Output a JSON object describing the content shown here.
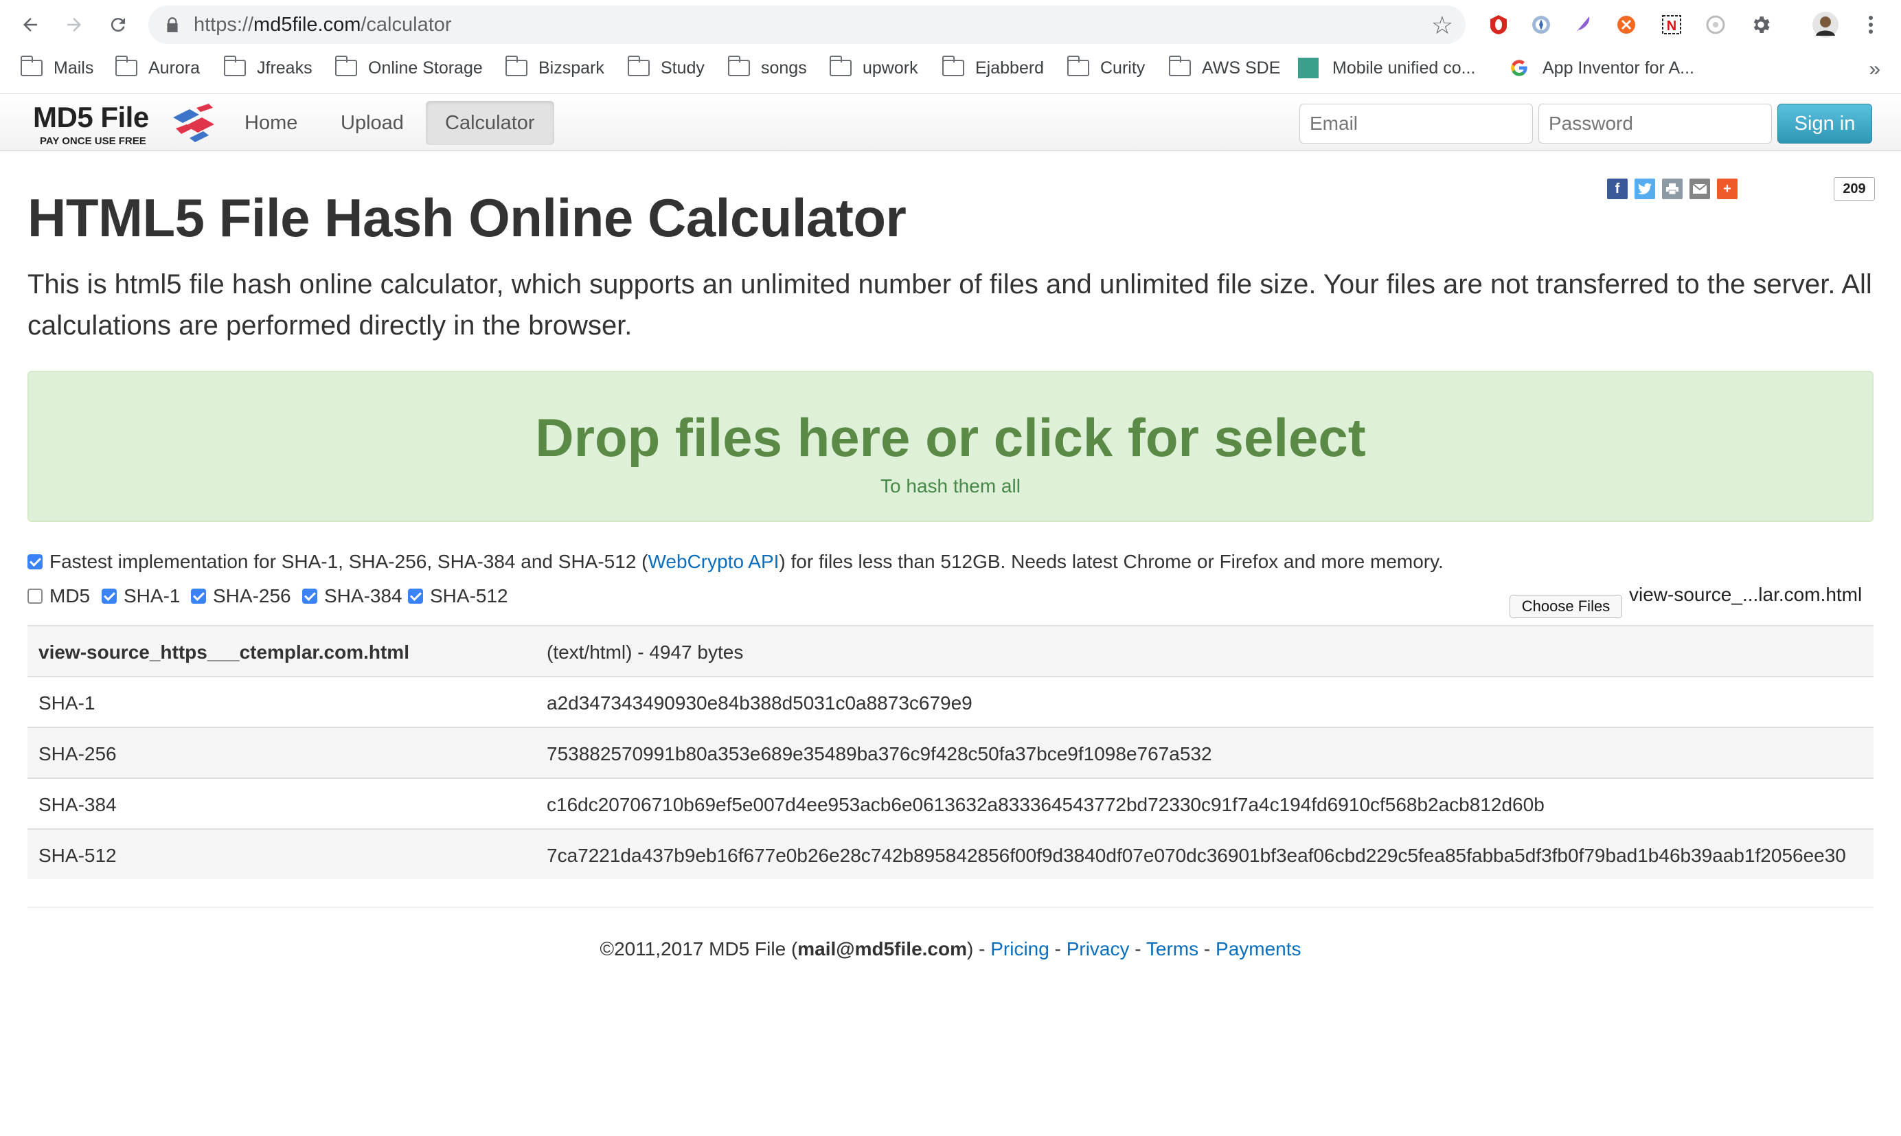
{
  "browser": {
    "url_scheme": "https://",
    "url_host": "md5file.com",
    "url_path": "/calculator",
    "bookmarks": [
      {
        "label": "Mails",
        "icon": "folder-icon"
      },
      {
        "label": "Aurora",
        "icon": "folder-icon"
      },
      {
        "label": "Jfreaks",
        "icon": "folder-icon"
      },
      {
        "label": "Online Storage",
        "icon": "folder-icon"
      },
      {
        "label": "Bizspark",
        "icon": "folder-icon"
      },
      {
        "label": "Study",
        "icon": "folder-icon"
      },
      {
        "label": "songs",
        "icon": "folder-icon"
      },
      {
        "label": "upwork",
        "icon": "folder-icon"
      },
      {
        "label": "Ejabberd",
        "icon": "folder-icon"
      },
      {
        "label": "Curity",
        "icon": "folder-icon"
      },
      {
        "label": "AWS SDE",
        "icon": "folder-icon"
      },
      {
        "label": "Mobile unified co...",
        "icon": "teal-square-icon"
      },
      {
        "label": "App Inventor for A...",
        "icon": "google-g-icon"
      }
    ],
    "bookmarks_more": "»"
  },
  "nav": {
    "brand": "MD5 File",
    "brand_tagline": "PAY ONCE USE FREE",
    "links": [
      "Home",
      "Upload",
      "Calculator"
    ],
    "active_link": "Calculator",
    "email_placeholder": "Email",
    "password_placeholder": "Password",
    "signin_label": "Sign in"
  },
  "share": {
    "icons": [
      "facebook-icon",
      "twitter-icon",
      "print-icon",
      "email-icon",
      "plus-icon"
    ],
    "count": "209"
  },
  "main": {
    "title": "HTML5 File Hash Online Calculator",
    "lead": "This is html5 file hash online calculator, which supports an unlimited number of files and unlimited file size. Your files are not transferred to the server. All calculations are performed directly in the browser.",
    "drop_title": "Drop files here or click for select",
    "drop_subtitle": "To hash them all",
    "fastest_prefix": "Fastest implementation for SHA-1, SHA-256, SHA-384 and SHA-512 (",
    "fastest_link": "WebCrypto API",
    "fastest_suffix": ") for files less than 512GB. Needs latest Chrome or Firefox and more memory.",
    "algorithms": [
      {
        "label": "MD5",
        "checked": false
      },
      {
        "label": "SHA-1",
        "checked": true
      },
      {
        "label": "SHA-256",
        "checked": true
      },
      {
        "label": "SHA-384",
        "checked": true
      },
      {
        "label": "SHA-512",
        "checked": true
      }
    ],
    "choose_files_label": "Choose Files",
    "chosen_file": "view-source_...lar.com.html"
  },
  "results": {
    "file_name": "view-source_https___ctemplar.com.html",
    "file_info": "(text/html) - 4947 bytes",
    "rows": [
      {
        "algo": "SHA-1",
        "hash": "a2d347343490930e84b388d5031c0a8873c679e9"
      },
      {
        "algo": "SHA-256",
        "hash": "753882570991b80a353e689e35489ba376c9f428c50fa37bce9f1098e767a532"
      },
      {
        "algo": "SHA-384",
        "hash": "c16dc20706710b69ef5e007d4ee953acb6e0613632a833364543772bd72330c91f7a4c194fd6910cf568b2acb812d60b"
      },
      {
        "algo": "SHA-512",
        "hash": "7ca7221da437b9eb16f677e0b26e28c742b895842856f00f9d3840df07e070dc36901bf3eaf06cbd229c5fea85fabba5df3fb0f79bad1b46b39aab1f2056ee30"
      }
    ]
  },
  "footer": {
    "copyright_prefix": "©2011,2017 MD5 File (",
    "email": "mail@md5file.com",
    "copyright_suffix": ") - ",
    "links": [
      "Pricing",
      "Privacy",
      "Terms",
      "Payments"
    ],
    "separator": " - "
  }
}
